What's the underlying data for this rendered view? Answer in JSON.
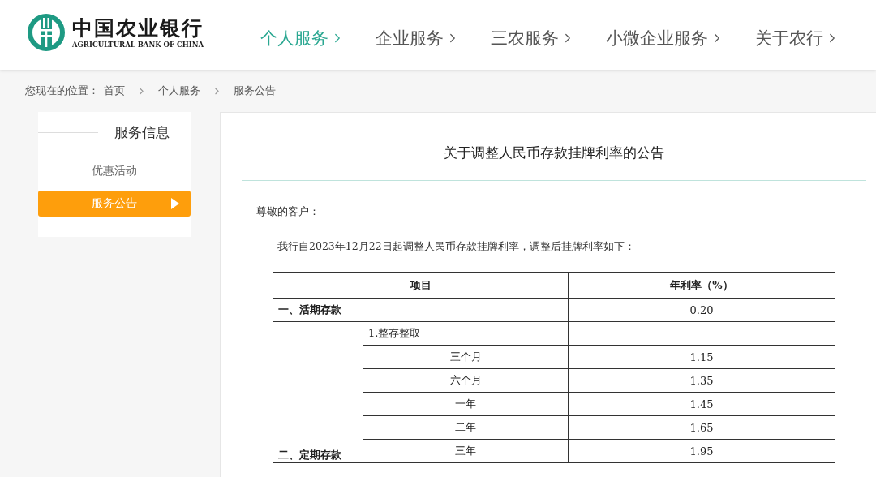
{
  "logo": {
    "name_cn": "中国农业银行",
    "name_en": "AGRICULTURAL BANK OF CHINA"
  },
  "nav": [
    {
      "label": "个人服务",
      "selected": true
    },
    {
      "label": "企业服务",
      "selected": false
    },
    {
      "label": "三农服务",
      "selected": false
    },
    {
      "label": "小微企业服务",
      "selected": false
    },
    {
      "label": "关于农行",
      "selected": false
    }
  ],
  "breadcrumb": {
    "prefix": "您现在的位置：",
    "items": [
      "首页",
      "个人服务",
      "服务公告"
    ]
  },
  "sidebar": {
    "title": "服务信息",
    "items": [
      {
        "label": "优惠活动",
        "selected": false
      },
      {
        "label": "服务公告",
        "selected": true
      }
    ]
  },
  "article": {
    "title": "关于调整人民币存款挂牌利率的公告",
    "greeting": "尊敬的客户：",
    "intro": "我行自2023年12月22日起调整人民币存款挂牌利率，调整后挂牌利率如下：",
    "table": {
      "columns": [
        "项目",
        "年利率（%）"
      ],
      "rows": [
        {
          "kind": "category",
          "label": "一、活期存款",
          "rate": "0.20"
        },
        {
          "kind": "group",
          "label": "二、定期存款",
          "subrows": [
            {
              "kind": "subhead",
              "label": "1.整存整取"
            },
            {
              "kind": "term",
              "label": "三个月",
              "rate": "1.15"
            },
            {
              "kind": "term",
              "label": "六个月",
              "rate": "1.35"
            },
            {
              "kind": "term",
              "label": "一年",
              "rate": "1.45"
            },
            {
              "kind": "term",
              "label": "二年",
              "rate": "1.65"
            },
            {
              "kind": "term",
              "label": "三年",
              "rate": "1.95"
            }
          ]
        }
      ]
    }
  }
}
